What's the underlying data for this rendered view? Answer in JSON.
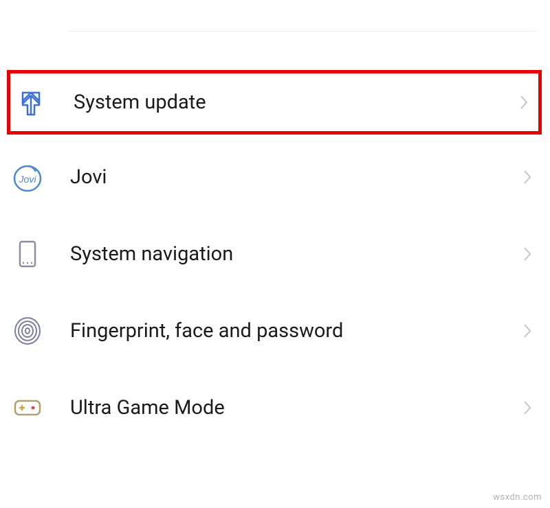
{
  "items": [
    {
      "id": "system-update",
      "label": "System update",
      "highlighted": true
    },
    {
      "id": "jovi",
      "label": "Jovi",
      "highlighted": false
    },
    {
      "id": "system-navigation",
      "label": "System navigation",
      "highlighted": false
    },
    {
      "id": "fingerprint",
      "label": "Fingerprint, face and password",
      "highlighted": false
    },
    {
      "id": "ultra-game-mode",
      "label": "Ultra Game Mode",
      "highlighted": false
    }
  ],
  "watermark": "wsxdn.com"
}
